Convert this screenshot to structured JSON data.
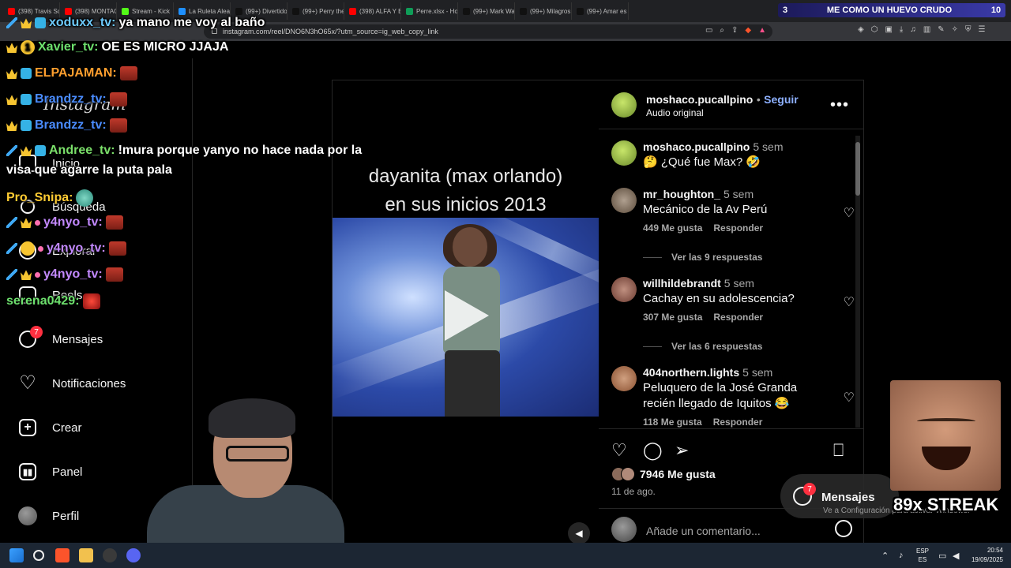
{
  "browser": {
    "tabs": [
      {
        "label": "(398) Travis Sc",
        "color": "#ff0000"
      },
      {
        "label": "(398) MONTAG",
        "color": "#ff0000"
      },
      {
        "label": "Stream - Kick",
        "color": "#53fc18"
      },
      {
        "label": "La Ruleta Alea",
        "color": "#1e90ff"
      },
      {
        "label": "(99+) Divertido",
        "color": "#111111"
      },
      {
        "label": "(99+) Perry the",
        "color": "#111111"
      },
      {
        "label": "(398) ALFA Y B",
        "color": "#ff0000"
      },
      {
        "label": "Perre.xlsx - Hoj",
        "color": "#0f9d58"
      },
      {
        "label": "(99+) Mark Wal",
        "color": "#111111"
      },
      {
        "label": "(99+) Milagros",
        "color": "#111111"
      },
      {
        "label": "(99+) Amar es c",
        "color": "#111111"
      }
    ],
    "url": "instagram.com/reel/DNO6N3hO65x/?utm_source=ig_web_copy_link"
  },
  "stream_bar": {
    "left_num": "3",
    "title": "ME COMO UN HUEVO CRUDO",
    "right_num": "10"
  },
  "sidebar": {
    "logo": "Instagram",
    "items": [
      {
        "label": "Inicio"
      },
      {
        "label": "Búsqueda"
      },
      {
        "label": "Explorar"
      },
      {
        "label": "Reels"
      },
      {
        "label": "Mensajes",
        "badge": "7"
      },
      {
        "label": "Notificaciones"
      },
      {
        "label": "Crear"
      },
      {
        "label": "Panel"
      },
      {
        "label": "Perfil"
      }
    ]
  },
  "chat": [
    {
      "name": "xoduxx_tv:",
      "msg": "ya mano me voy al baño"
    },
    {
      "name": "Xavier_tv:",
      "msg": "OE ES MICRO JJAJA",
      "badge_num": "1"
    },
    {
      "name": "ELPAJAMAN:",
      "msg": ""
    },
    {
      "name": "Brandzz_tv:",
      "msg": ""
    },
    {
      "name": "Brandzz_tv:",
      "msg": ""
    },
    {
      "name": "Andree_tv:",
      "msg": "!mura porque yanyo no hace nada por la"
    },
    {
      "name": "",
      "msg": "visa que agarre la puta pala"
    },
    {
      "name": "Pro_Snipa:",
      "msg": ""
    },
    {
      "name": "y4nyo_tv:",
      "msg": ""
    },
    {
      "name": "y4nyo_tv:",
      "msg": ""
    },
    {
      "name": "y4nyo_tv:",
      "msg": ""
    },
    {
      "name": "serena0429:",
      "msg": ""
    }
  ],
  "video": {
    "title_line1": "dayanita (max orlando)",
    "title_line2": "en sus inicios  2013"
  },
  "post": {
    "author": "moshaco.pucallpino",
    "separator": "•",
    "follow": "Seguir",
    "audio": "Audio original",
    "comments": [
      {
        "user": "moshaco.pucallpino",
        "ago": "5 sem",
        "text": "🤔 ¿Qué fue Max? 🤣",
        "likes": "",
        "reply": ""
      },
      {
        "user": "mr_houghton_",
        "ago": "5 sem",
        "text": "Mecánico de la Av Perú",
        "likes": "449 Me gusta",
        "reply": "Responder",
        "view_replies": "Ver las 9 respuestas"
      },
      {
        "user": "willhildebrandt",
        "ago": "5 sem",
        "text": "Cachay en su adolescencia?",
        "likes": "307 Me gusta",
        "reply": "Responder",
        "view_replies": "Ver las 6 respuestas"
      },
      {
        "user": "404northern.lights",
        "ago": "5 sem",
        "text": "Peluquero de la José Granda recién llegado de Iquitos 😂",
        "likes": "118 Me gusta",
        "reply": "Responder"
      }
    ],
    "likes_count": "7946 Me gusta",
    "date": "11 de ago.",
    "add_comment_placeholder": "Añade un comentario..."
  },
  "overlay": {
    "messages_label": "Mensajes",
    "messages_badge": "7",
    "activate_windows": "Ve a Configuración para activar Windows.",
    "streak": "89x STREAK"
  },
  "taskbar": {
    "lang_line1": "ESP",
    "lang_line2": "ES",
    "time": "20:54",
    "date": "19/09/2025"
  },
  "colors": {
    "accent_link": "#8db0ff",
    "badge_red": "#ff3040",
    "taskbar": "#1c2633"
  }
}
